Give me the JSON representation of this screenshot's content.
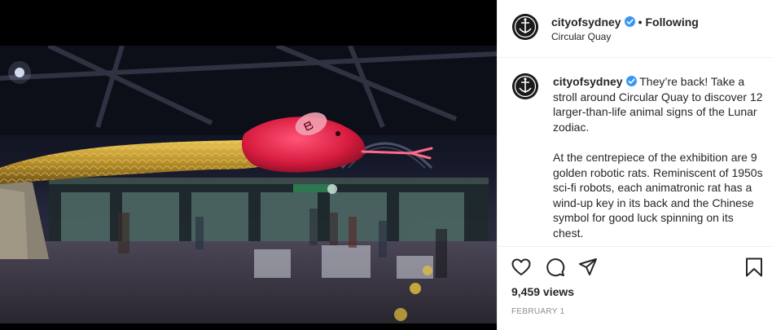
{
  "post": {
    "username": "cityofsydney",
    "follow_separator": "•",
    "follow_label": "Following",
    "location": "Circular Quay",
    "caption_paragraph_1": "They’re back! Take a stroll around Circular Quay to discover 12 larger-than-life animal signs of the Lunar zodiac.",
    "caption_paragraph_2": "At the centrepiece of the exhibition are 9 golden robotic rats. Reminiscent of 1950s sci-fi robots, each animatronic rat has a wind-up key in its back and the Chinese symbol for good luck spinning on its chest.",
    "views": "9,459 views",
    "date": "FEBRUARY 1"
  },
  "icons": {
    "like": "heart-icon",
    "comment": "comment-icon",
    "share": "paper-plane-icon",
    "save": "bookmark-icon",
    "verified": "verified-badge-icon"
  },
  "colors": {
    "verified_blue": "#3897f0",
    "snake_gold": "#c9a233",
    "snake_red": "#e0264a",
    "muted_text": "#8e8e8e"
  }
}
